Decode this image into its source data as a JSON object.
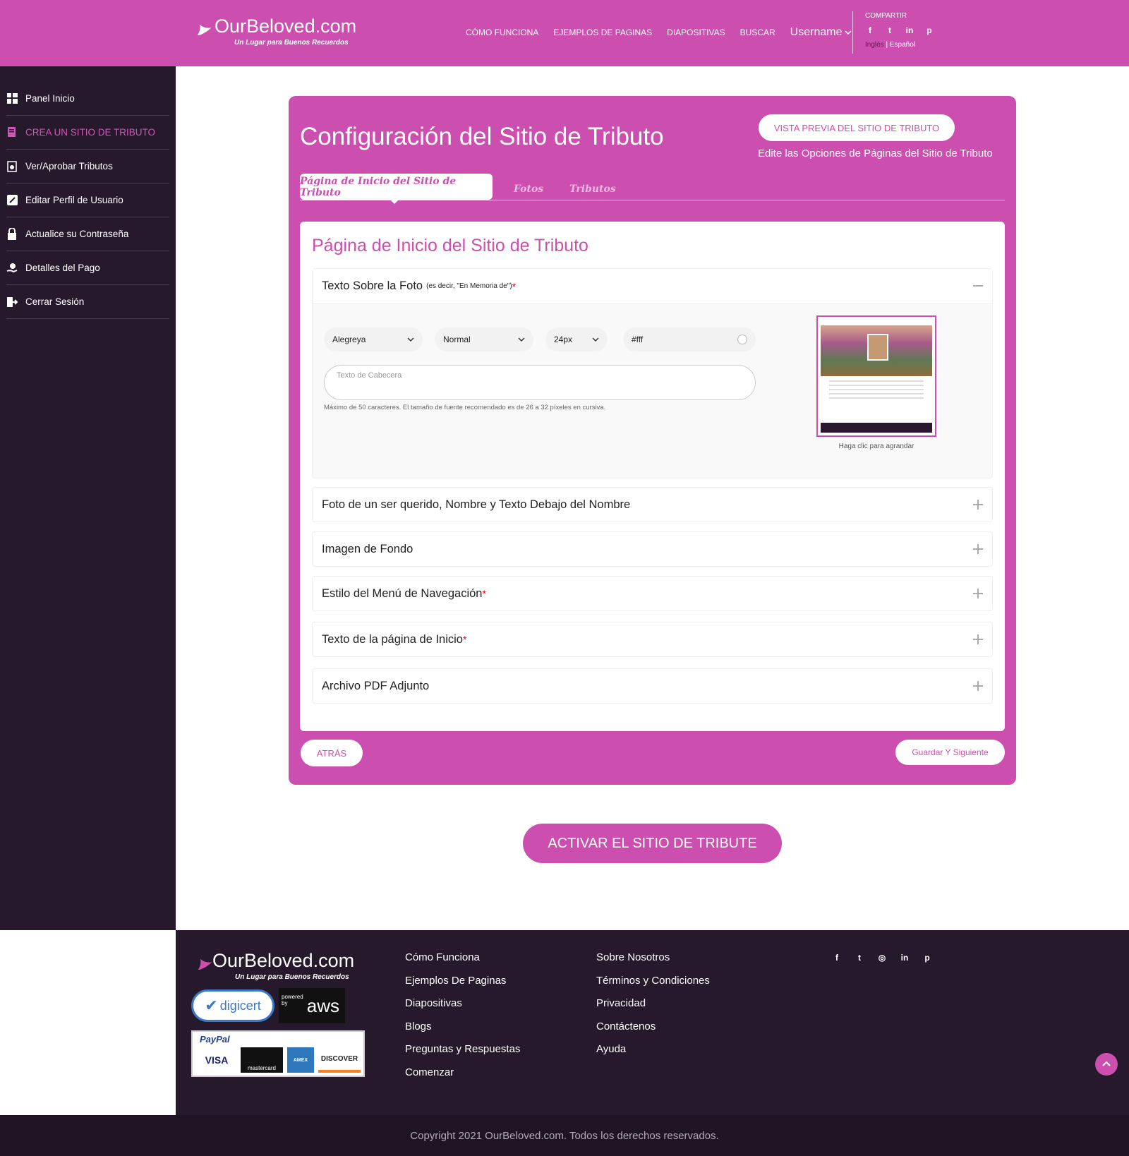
{
  "brand": {
    "name": "OurBeloved.com",
    "tagline": "Un Lugar para Buenos Recuerdos",
    "accent": "#cc4faf",
    "dark": "#27192c"
  },
  "nav": {
    "items": [
      "CÓMO FUNCIONA",
      "EJEMPLOS DE PAGINAS",
      "DIAPOSITIVAS",
      "BUSCAR"
    ],
    "user": "Username",
    "share_label": "COMPARTIR",
    "lang_en": "Inglés",
    "lang_sep": " | ",
    "lang_es": "Español"
  },
  "sidebar": {
    "items": [
      {
        "label": "Panel Inicio",
        "icon": "dashboard-icon"
      },
      {
        "label": "CREA UN SITIO DE TRIBUTO",
        "icon": "create-site-icon"
      },
      {
        "label": "Ver/Aprobar Tributos",
        "icon": "approve-icon"
      },
      {
        "label": "Editar Perfil de Usuario",
        "icon": "edit-icon"
      },
      {
        "label": "Actualice su Contraseña",
        "icon": "lock-icon"
      },
      {
        "label": "Detalles del Pago",
        "icon": "payment-icon"
      },
      {
        "label": "Cerrar Sesión",
        "icon": "logout-icon"
      }
    ]
  },
  "main": {
    "title": "Configuración del Sitio de Tributo",
    "preview_button": "VISTA PREVIA DEL SITIO DE TRIBUTO",
    "subtitle": "Edite las Opciones de Páginas del Sitio de Tributo",
    "tabs": [
      "Página de Inicio del Sitio de Tributo",
      "Fotos",
      "Tributos"
    ],
    "panel_title": "Página de Inicio del Sitio de Tributo",
    "open_section": {
      "title": "Texto Sobre la Foto",
      "note": "(es decir, \"En Memoria de\")",
      "required": "*",
      "font": "Alegreya",
      "style": "Normal",
      "size": "24px",
      "color": "#fff",
      "placeholder": "Texto de Cabecera",
      "hint": "Máximo de 50 caracteres. El tamaño de fuente recomendado es de 26 a 32 píxeles en cursiva.",
      "thumb_caption": "Haga clic para agrandar"
    },
    "sections": [
      {
        "title": "Foto de un ser querido, Nombre y Texto Debajo del Nombre",
        "required": ""
      },
      {
        "title": "Imagen de Fondo",
        "required": ""
      },
      {
        "title": "Estilo del Menú de Navegación",
        "required": "*"
      },
      {
        "title": "Texto de la página de Inicio",
        "required": "*"
      },
      {
        "title": "Archivo PDF Adjunto",
        "required": ""
      }
    ],
    "back_button": "ATRÁS",
    "next_button": "Guardar Y Siguiente",
    "activate_button": "ACTIVAR EL SITIO DE TRIBUTE"
  },
  "footer": {
    "col1": [
      "Cómo Funciona",
      "Ejemplos De Paginas",
      "Diapositivas",
      "Blogs",
      "Preguntas y Respuestas",
      "Comenzar"
    ],
    "col2": [
      "Sobre Nosotros",
      "Términos y Condiciones",
      "Privacidad",
      "Contáctenos",
      "Ayuda"
    ],
    "digicert": "digicert",
    "aws_powered": "powered by",
    "aws": "aws",
    "paypal": "PayPal",
    "cards": [
      "VISA",
      "mastercard",
      "AMEX",
      "DISCOVER"
    ],
    "copyright": "Copyright 2021 OurBeloved.com. Todos los derechos reservados."
  }
}
